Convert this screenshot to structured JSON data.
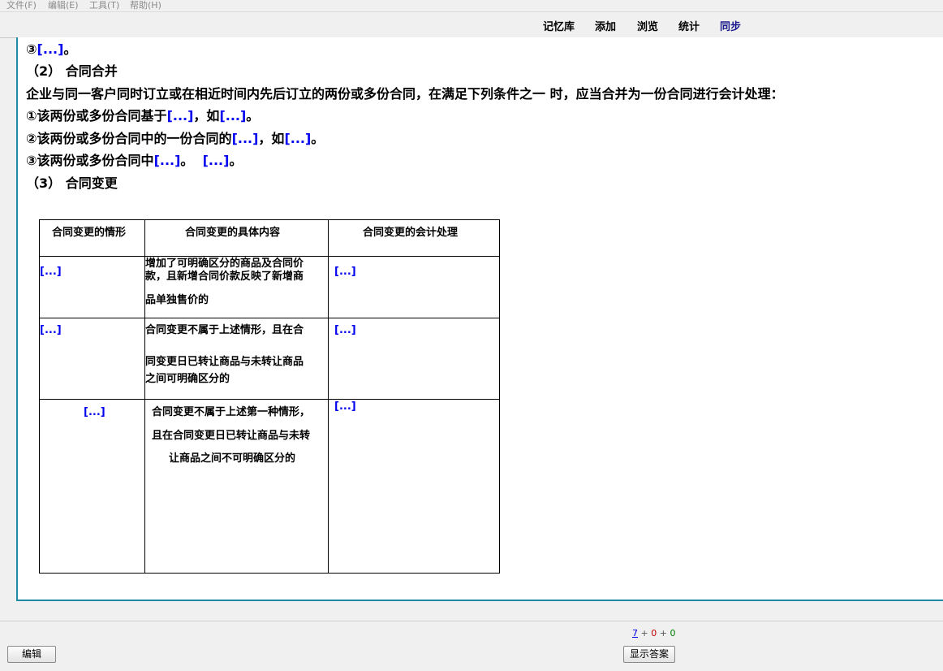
{
  "menu": [
    "文件(F)",
    "编辑(E)",
    "工具(T)",
    "帮助(H)"
  ],
  "nav": [
    "记忆库",
    "添加",
    "浏览",
    "统计",
    "同步"
  ],
  "card": {
    "line1": {
      "prefix": "③",
      "cloze": "[...]",
      "suffix": "。"
    },
    "heading2": "（2） 合同合并",
    "para": "企业与同一客户同时订立或在相近时间内先后订立的两份或多份合同，在满足下列条件之一  时，应当合并为一份合同进行会计处理：",
    "cond1": {
      "prefix": "①该两份或多份合同基于",
      "cloze1": "[...]",
      "mid": "，如",
      "cloze2": "[...]",
      "suffix": "。"
    },
    "cond2": {
      "prefix": "②该两份或多份合同中的一份合同的",
      "cloze1": "[...]",
      "mid": "，如",
      "cloze2": "[...]",
      "suffix": "。"
    },
    "cond3": {
      "prefix": "③该两份或多份合同中",
      "cloze1": "[...]",
      "mid": "。  ",
      "cloze2": "[...]",
      "suffix": "。"
    },
    "heading3": "（3） 合同变更",
    "table": {
      "headers": [
        "合同变更的情形",
        "合同变更的具体内容",
        "合同变更的会计处理"
      ],
      "rows": [
        {
          "situation": "[...]",
          "content": [
            "增加了可明确区分的商品及合同价",
            "款，且新增合同价款反映了新增商",
            "品单独售价的"
          ],
          "treatment": "[...]"
        },
        {
          "situation": "[...]",
          "content": [
            "合同变更不属于上述情形，且在合",
            "同变更日已转让商品与未转让商品",
            "之间可明确区分的"
          ],
          "treatment": "[...]"
        },
        {
          "situation": "[...]",
          "content": [
            "合同变更不属于上述第一种情形，",
            "且在合同变更日已转让商品与未转",
            "让商品之间不可明确区分的"
          ],
          "treatment": "[...]"
        }
      ]
    }
  },
  "bottom": {
    "edit_label": "编辑",
    "show_answer_label": "显示答案",
    "counts": {
      "new": "7",
      "learning": "0",
      "review": "0",
      "sep": "+"
    }
  },
  "colors": {
    "cloze": "#0000ee",
    "frame": "#1f8ba4",
    "new": "#0000ee",
    "learning": "#c00000",
    "review": "#008000"
  }
}
